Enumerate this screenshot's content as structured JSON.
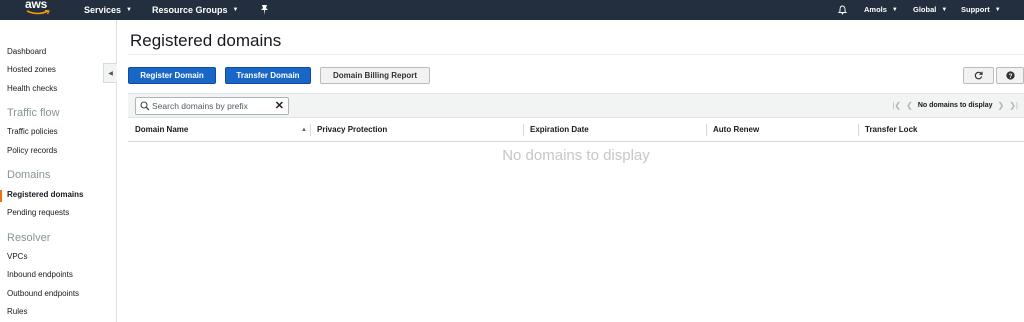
{
  "topnav": {
    "logo_text": "aws",
    "services": "Services",
    "resource_groups": "Resource Groups",
    "account": "Amols",
    "region": "Global",
    "support": "Support"
  },
  "sidebar": {
    "links_top": [
      "Dashboard",
      "Hosted zones",
      "Health checks"
    ],
    "traffic_flow": {
      "heading": "Traffic flow",
      "items": [
        "Traffic policies",
        "Policy records"
      ]
    },
    "domains": {
      "heading": "Domains",
      "items": [
        "Registered domains",
        "Pending requests"
      ],
      "active": "Registered domains"
    },
    "resolver": {
      "heading": "Resolver",
      "items": [
        "VPCs",
        "Inbound endpoints",
        "Outbound endpoints",
        "Rules"
      ]
    }
  },
  "page": {
    "title": "Registered domains",
    "buttons": {
      "register": "Register Domain",
      "transfer": "Transfer Domain",
      "billing": "Domain Billing Report"
    },
    "search_placeholder": "Search domains by prefix",
    "pager_text": "No domains to display",
    "columns": [
      "Domain Name",
      "Privacy Protection",
      "Expiration Date",
      "Auto Renew",
      "Transfer Lock"
    ],
    "empty_message": "No domains to display"
  },
  "colors": {
    "nav_bg": "#232f3e",
    "primary_button": "#1866c8",
    "active_accent": "#ec7211"
  },
  "icons": [
    "bell-icon",
    "pin-icon",
    "search-icon",
    "clear-icon",
    "refresh-icon",
    "help-icon",
    "collapse-icon",
    "first-page-icon",
    "prev-page-icon",
    "next-page-icon",
    "last-page-icon",
    "sort-asc-icon"
  ]
}
